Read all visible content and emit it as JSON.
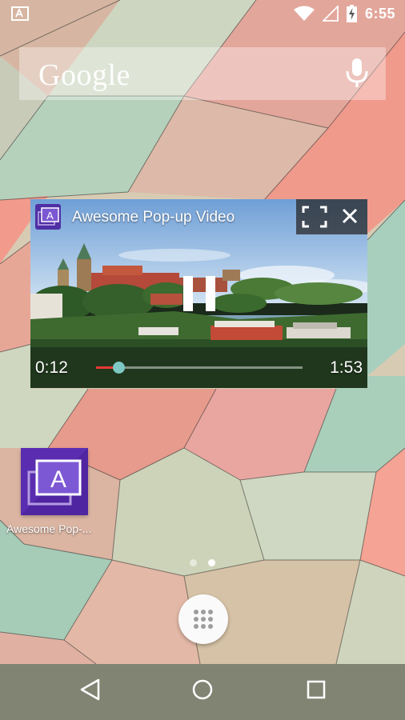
{
  "status_bar": {
    "time": "6:55",
    "icons": [
      "keyboard-notification-icon",
      "wifi-icon",
      "signal-icon",
      "battery-charging-icon"
    ]
  },
  "search_widget": {
    "brand": "Google",
    "mic_icon": "mic-icon"
  },
  "popup_player": {
    "title": "Awesome Pop-up Video",
    "app_badge_letter": "A",
    "current_time": "0:12",
    "total_time": "1:53",
    "progress": 0.11,
    "buttons": [
      "fullscreen-icon",
      "close-icon",
      "pause-icon"
    ]
  },
  "home": {
    "app_icon_letter": "A",
    "app_label": "Awesome Pop-...",
    "page_count": 2,
    "active_page": 1
  },
  "nav_bar": {
    "items": [
      "back-icon",
      "home-icon",
      "recents-icon"
    ]
  },
  "colors": {
    "accent_purple": "#5a2cb0",
    "seek_red": "#e53935",
    "seek_thumb": "#7ec8c3"
  }
}
